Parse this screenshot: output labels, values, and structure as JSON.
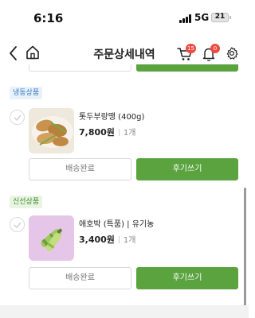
{
  "status_bar": {
    "time": "6:16",
    "network": "5G",
    "battery": "21"
  },
  "header": {
    "title": "주문상세내역",
    "cart_count": "15",
    "notification_count": "0"
  },
  "orders": [
    {
      "category": "냉동상품",
      "name": "톳두부랑땡 (400g)",
      "price": "7,800원",
      "quantity": "1개",
      "status_button": "배송완료",
      "review_button": "후기쓰기"
    },
    {
      "category": "신선상품",
      "name": "애호박 (특품) | 유기농",
      "price": "3,400원",
      "quantity": "1개",
      "status_button": "배송완료",
      "review_button": "후기쓰기"
    }
  ],
  "colors": {
    "accent_green": "#5aa33f",
    "badge_red": "#ef4a3f",
    "frozen_tag": "#3c79c6",
    "fresh_tag": "#3d8a2d"
  }
}
